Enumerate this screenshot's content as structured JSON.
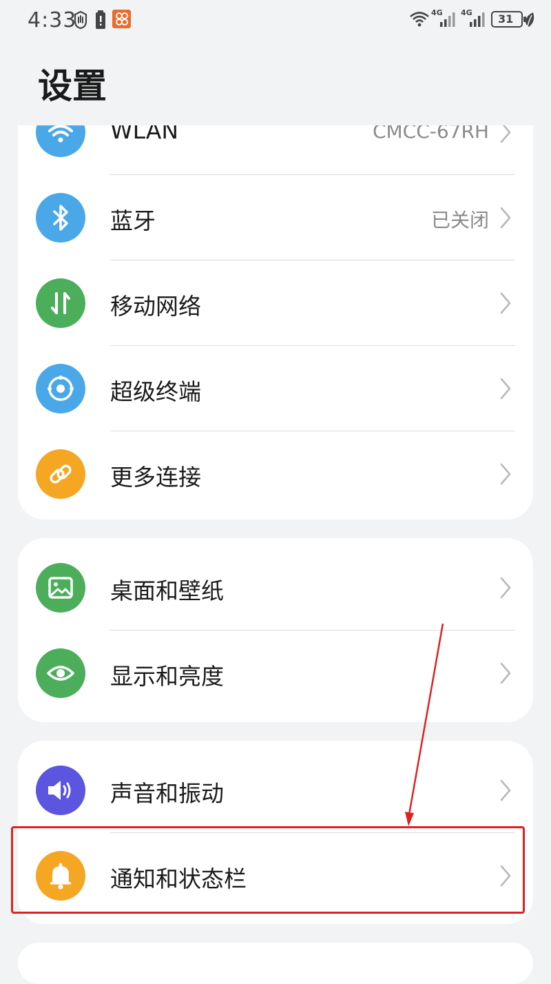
{
  "status_bar": {
    "time": "4:33",
    "left_icons": [
      "hand-icon",
      "battery-alert-icon",
      "app-badge-icon"
    ],
    "right_icons": [
      "wifi-icon",
      "signal-4g-icon",
      "signal-4g-icon",
      "battery-icon",
      "leaf-icon"
    ],
    "network_label_1": "4G",
    "network_label_2": "4G",
    "battery_level": "31"
  },
  "header": {
    "title": "设置"
  },
  "card1": {
    "items": [
      {
        "label": "WLAN",
        "value": "CMCC-67RH",
        "icon": "wifi-icon",
        "color": "#4aa8e8"
      },
      {
        "label": "蓝牙",
        "value": "已关闭",
        "icon": "bluetooth-icon",
        "color": "#4aa8e8"
      },
      {
        "label": "移动网络",
        "value": "",
        "icon": "mobile-data-icon",
        "color": "#4cae5a"
      },
      {
        "label": "超级终端",
        "value": "",
        "icon": "super-device-icon",
        "color": "#4aa8e8"
      },
      {
        "label": "更多连接",
        "value": "",
        "icon": "link-icon",
        "color": "#f5a623"
      }
    ]
  },
  "card2": {
    "items": [
      {
        "label": "桌面和壁纸",
        "icon": "wallpaper-icon",
        "color": "#4cae5a"
      },
      {
        "label": "显示和亮度",
        "icon": "eye-icon",
        "color": "#4cae5a"
      }
    ]
  },
  "card3": {
    "items": [
      {
        "label": "声音和振动",
        "icon": "speaker-icon",
        "color": "#5b55e0"
      },
      {
        "label": "通知和状态栏",
        "icon": "bell-icon",
        "color": "#f5a623"
      }
    ]
  },
  "annotation": {
    "highlight_color": "#e02020"
  }
}
